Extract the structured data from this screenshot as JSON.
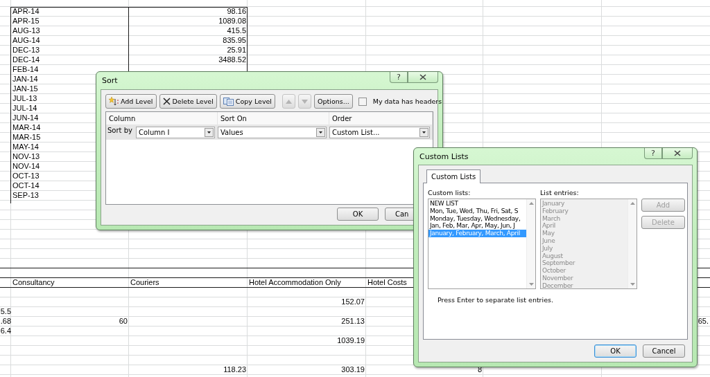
{
  "sheet": {
    "top_table": {
      "rows": [
        {
          "month": "APR-14",
          "amount": "98.16"
        },
        {
          "month": "APR-15",
          "amount": "1089.08"
        },
        {
          "month": "AUG-13",
          "amount": "415.5"
        },
        {
          "month": "AUG-14",
          "amount": "835.95"
        },
        {
          "month": "DEC-13",
          "amount": "25.91"
        },
        {
          "month": "DEC-14",
          "amount": "3488.52"
        },
        {
          "month": "FEB-14"
        },
        {
          "month": "JAN-14"
        },
        {
          "month": "JAN-15"
        },
        {
          "month": "JUL-13"
        },
        {
          "month": "JUL-14"
        },
        {
          "month": "JUN-14"
        },
        {
          "month": "MAR-14"
        },
        {
          "month": "MAR-15"
        },
        {
          "month": "MAY-14"
        },
        {
          "month": "NOV-13"
        },
        {
          "month": "NOV-14"
        },
        {
          "month": "OCT-13"
        },
        {
          "month": "OCT-14"
        },
        {
          "month": "SEP-13"
        }
      ]
    },
    "bottom_table": {
      "header": [
        "Consultancy",
        "Couriers",
        "Hotel Accommodation Only",
        "Hotel Costs"
      ],
      "rows": [
        {
          "cells": {}
        },
        {
          "cells": {
            "column_3": "152.07"
          }
        },
        {
          "cells": {
            "column_0": "5.5"
          }
        },
        {
          "cells": {
            "column_0": ".68",
            "column_1": "60",
            "column_3": "251.13",
            "column_6": "65."
          }
        },
        {
          "cells": {
            "column_0": "6.4"
          }
        },
        {
          "cells": {
            "column_3": "1039.19"
          }
        },
        {
          "cells": {}
        },
        {
          "cells": {}
        },
        {
          "cells": {
            "column_2": "118.23",
            "column_3": "303.19",
            "column_4": "8"
          }
        }
      ]
    }
  },
  "sort_dialog": {
    "title": "Sort",
    "help_button": "?",
    "toolbar": [
      {
        "kind": "add",
        "label": "Add Level",
        "disabled": false
      },
      {
        "kind": "delete",
        "label": "Delete Level",
        "disabled": false
      },
      {
        "kind": "copy",
        "label": "Copy Level",
        "disabled": false
      },
      {
        "kind": "up",
        "disabled": true
      },
      {
        "kind": "down",
        "disabled": true
      },
      {
        "kind": "options",
        "label": "Options...",
        "disabled": false
      }
    ],
    "headers_checkbox": {
      "label": "My data has headers",
      "checked": false
    },
    "columns": [
      "Column",
      "Sort On",
      "Order"
    ],
    "levels": [
      {
        "label": "Sort by",
        "column": "Column I",
        "sort_on": "Values",
        "order": "Custom List..."
      }
    ],
    "buttons": [
      {
        "label": "OK"
      },
      {
        "label": "Can"
      }
    ]
  },
  "custom_lists_dialog": {
    "title": "Custom Lists",
    "help_button": "?",
    "tabs": [
      {
        "label": "Custom Lists",
        "selected": true
      }
    ],
    "lists_label": "Custom lists:",
    "lists": [
      {
        "label": "NEW LIST",
        "selected": false
      },
      {
        "label": "Mon, Tue, Wed, Thu, Fri, Sat, S",
        "selected": false
      },
      {
        "label": "Monday, Tuesday, Wednesday,",
        "selected": false
      },
      {
        "label": "Jan, Feb, Mar, Apr, May, Jun, J",
        "selected": false
      },
      {
        "label": "January, February, March, April",
        "selected": true
      }
    ],
    "entries_label": "List entries:",
    "entries_disabled": true,
    "entries": [
      "January",
      "February",
      "March",
      "April",
      "May",
      "June",
      "July",
      "August",
      "September",
      "October",
      "November",
      "December"
    ],
    "side_buttons": [
      {
        "label": "Add",
        "disabled": true
      },
      {
        "label": "Delete",
        "disabled": true
      }
    ],
    "hint": "Press Enter to separate list entries.",
    "buttons": [
      {
        "label": "OK",
        "default": true
      },
      {
        "label": "Cancel",
        "default": false
      }
    ]
  }
}
